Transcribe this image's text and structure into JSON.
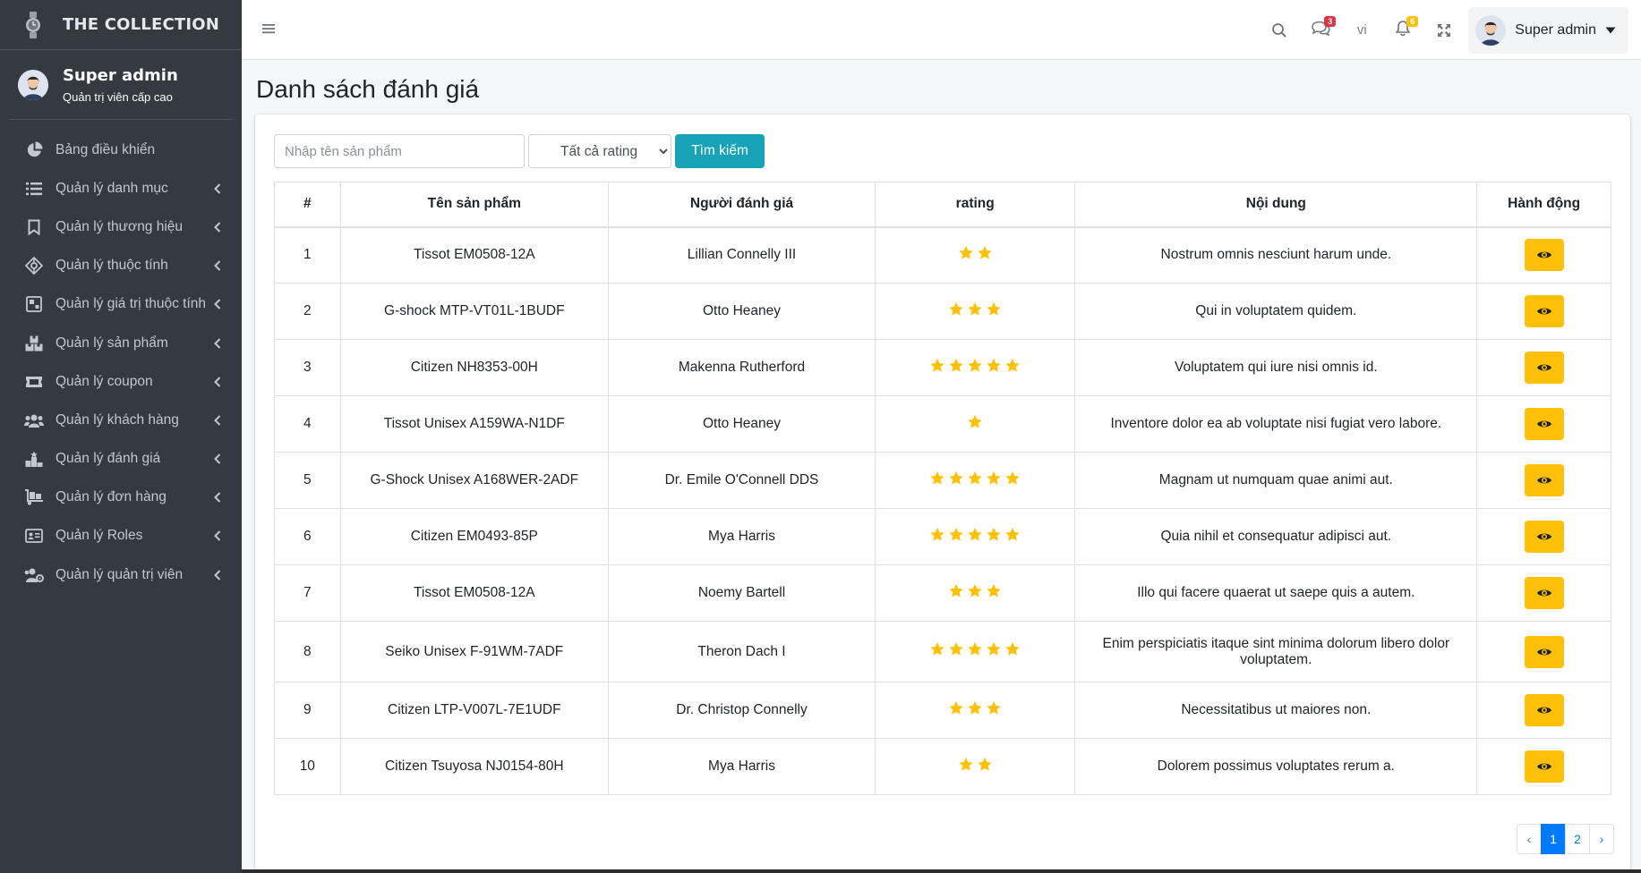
{
  "brand": {
    "name": "THE COLLECTION"
  },
  "user": {
    "name": "Super admin",
    "role": "Quản trị viên cấp cao"
  },
  "sidebar": {
    "items": [
      {
        "label": "Bảng điều khiển",
        "icon": "chart-pie-icon",
        "has_arrow": false
      },
      {
        "label": "Quản lý danh mục",
        "icon": "list-icon",
        "has_arrow": true
      },
      {
        "label": "Quản lý thương hiệu",
        "icon": "bookmark-icon",
        "has_arrow": true
      },
      {
        "label": "Quản lý thuộc tính",
        "icon": "attribute-icon",
        "has_arrow": true
      },
      {
        "label": "Quản lý giá trị thuộc tính",
        "icon": "attribute-value-icon",
        "has_arrow": true
      },
      {
        "label": "Quản lý sản phẩm",
        "icon": "boxes-icon",
        "has_arrow": true
      },
      {
        "label": "Quản lý coupon",
        "icon": "ticket-icon",
        "has_arrow": true
      },
      {
        "label": "Quản lý khách hàng",
        "icon": "users-icon",
        "has_arrow": true
      },
      {
        "label": "Quản lý đánh giá",
        "icon": "podium-icon",
        "has_arrow": true
      },
      {
        "label": "Quản lý đơn hàng",
        "icon": "dolly-icon",
        "has_arrow": true
      },
      {
        "label": "Quản lý Roles",
        "icon": "id-card-icon",
        "has_arrow": true
      },
      {
        "label": "Quản lý quản trị viên",
        "icon": "users-cog-icon",
        "has_arrow": true
      }
    ]
  },
  "topbar": {
    "messages_badge": "3",
    "notifications_badge": "6",
    "language": "vi",
    "user_name": "Super admin"
  },
  "page": {
    "title": "Danh sách đánh giá"
  },
  "filters": {
    "search_placeholder": "Nhập tên sản phẩm",
    "rating_selected": "Tất cả rating",
    "search_button": "Tìm kiếm"
  },
  "table": {
    "headers": [
      "#",
      "Tên sản phẩm",
      "Người đánh giá",
      "rating",
      "Nội dung",
      "Hành động"
    ],
    "rows": [
      {
        "no": "1",
        "product": "Tissot EM0508-12A",
        "reviewer": "Lillian Connelly III",
        "rating": 2,
        "content": "Nostrum omnis nesciunt harum unde."
      },
      {
        "no": "2",
        "product": "G-shock MTP-VT01L-1BUDF",
        "reviewer": "Otto Heaney",
        "rating": 3,
        "content": "Qui in voluptatem quidem."
      },
      {
        "no": "3",
        "product": "Citizen NH8353-00H",
        "reviewer": "Makenna Rutherford",
        "rating": 5,
        "content": "Voluptatem qui iure nisi omnis id."
      },
      {
        "no": "4",
        "product": "Tissot Unisex A159WA-N1DF",
        "reviewer": "Otto Heaney",
        "rating": 1,
        "content": "Inventore dolor ea ab voluptate nisi fugiat vero labore."
      },
      {
        "no": "5",
        "product": "G-Shock Unisex A168WER-2ADF",
        "reviewer": "Dr. Emile O'Connell DDS",
        "rating": 5,
        "content": "Magnam ut numquam quae animi aut."
      },
      {
        "no": "6",
        "product": "Citizen EM0493-85P",
        "reviewer": "Mya Harris",
        "rating": 5,
        "content": "Quia nihil et consequatur adipisci aut."
      },
      {
        "no": "7",
        "product": "Tissot EM0508-12A",
        "reviewer": "Noemy Bartell",
        "rating": 3,
        "content": "Illo qui facere quaerat ut saepe quis a autem."
      },
      {
        "no": "8",
        "product": "Seiko Unisex F-91WM-7ADF",
        "reviewer": "Theron Dach I",
        "rating": 5,
        "content": "Enim perspiciatis itaque sint minima dolorum libero dolor voluptatem."
      },
      {
        "no": "9",
        "product": "Citizen LTP-V007L-7E1UDF",
        "reviewer": "Dr. Christop Connelly",
        "rating": 3,
        "content": "Necessitatibus ut maiores non."
      },
      {
        "no": "10",
        "product": "Citizen Tsuyosa NJ0154-80H",
        "reviewer": "Mya Harris",
        "rating": 2,
        "content": "Dolorem possimus voluptates rerum a."
      }
    ]
  },
  "pagination": {
    "prev": "‹",
    "pages": [
      "1",
      "2"
    ],
    "active": "1",
    "next": "›"
  },
  "colors": {
    "sidebar": "#343a40",
    "star": "#ffc107",
    "action": "#ffc107",
    "search_button": "#17a2b8",
    "active_page": "#007bff"
  }
}
